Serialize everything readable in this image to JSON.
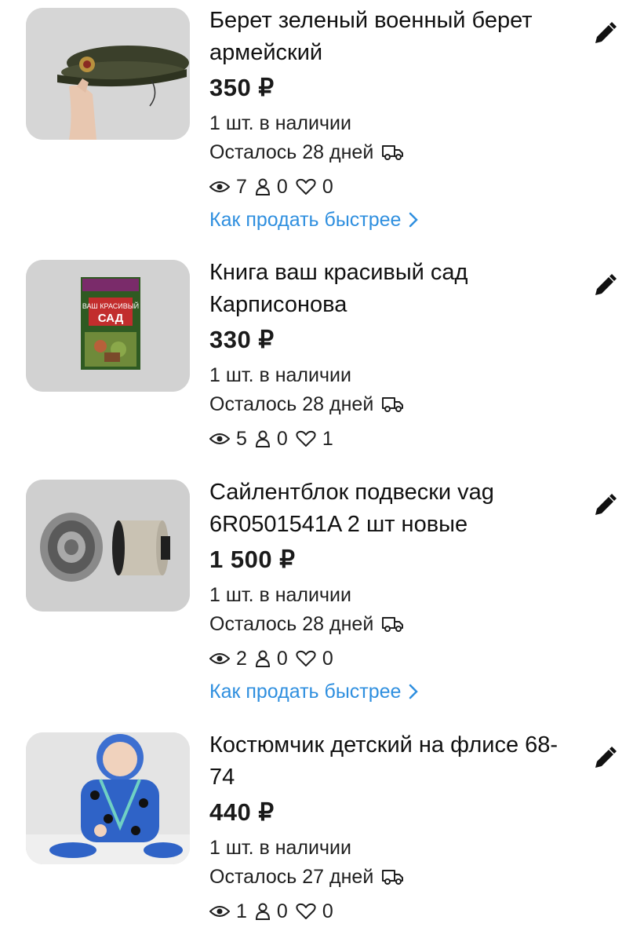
{
  "listings": [
    {
      "title": "Берет зеленый военный берет армейский",
      "price": "350 ₽",
      "stock": "1 шт. в наличии",
      "expires": "Осталось 28 дней",
      "views": "7",
      "contacts": "0",
      "favorites": "0",
      "sell_faster": "Как продать быстрее"
    },
    {
      "title": "Книга ваш красивый сад Карписонова",
      "price": "330 ₽",
      "stock": "1 шт. в наличии",
      "expires": "Осталось 28 дней",
      "views": "5",
      "contacts": "0",
      "favorites": "1",
      "book_cover_text": "ВАШ КРАСИВЫЙ САД"
    },
    {
      "title": "Сайлентблок подвески vag 6R0501541A 2 шт новые",
      "price": "1 500 ₽",
      "stock": "1 шт. в наличии",
      "expires": "Осталось 28 дней",
      "views": "2",
      "contacts": "0",
      "favorites": "0",
      "sell_faster": "Как продать быстрее"
    },
    {
      "title": "Костюмчик детский на флисе 68-74",
      "price": "440 ₽",
      "stock": "1 шт. в наличии",
      "expires": "Осталось 27 дней",
      "views": "1",
      "contacts": "0",
      "favorites": "0"
    }
  ],
  "icons": {
    "edit": "pencil-icon",
    "delivery": "truck-icon",
    "views": "eye-icon",
    "contacts": "person-icon",
    "favorites": "heart-icon",
    "link_arrow": "chevron-right-icon"
  },
  "colors": {
    "link": "#2f8fdf",
    "text": "#1a1a1a"
  }
}
